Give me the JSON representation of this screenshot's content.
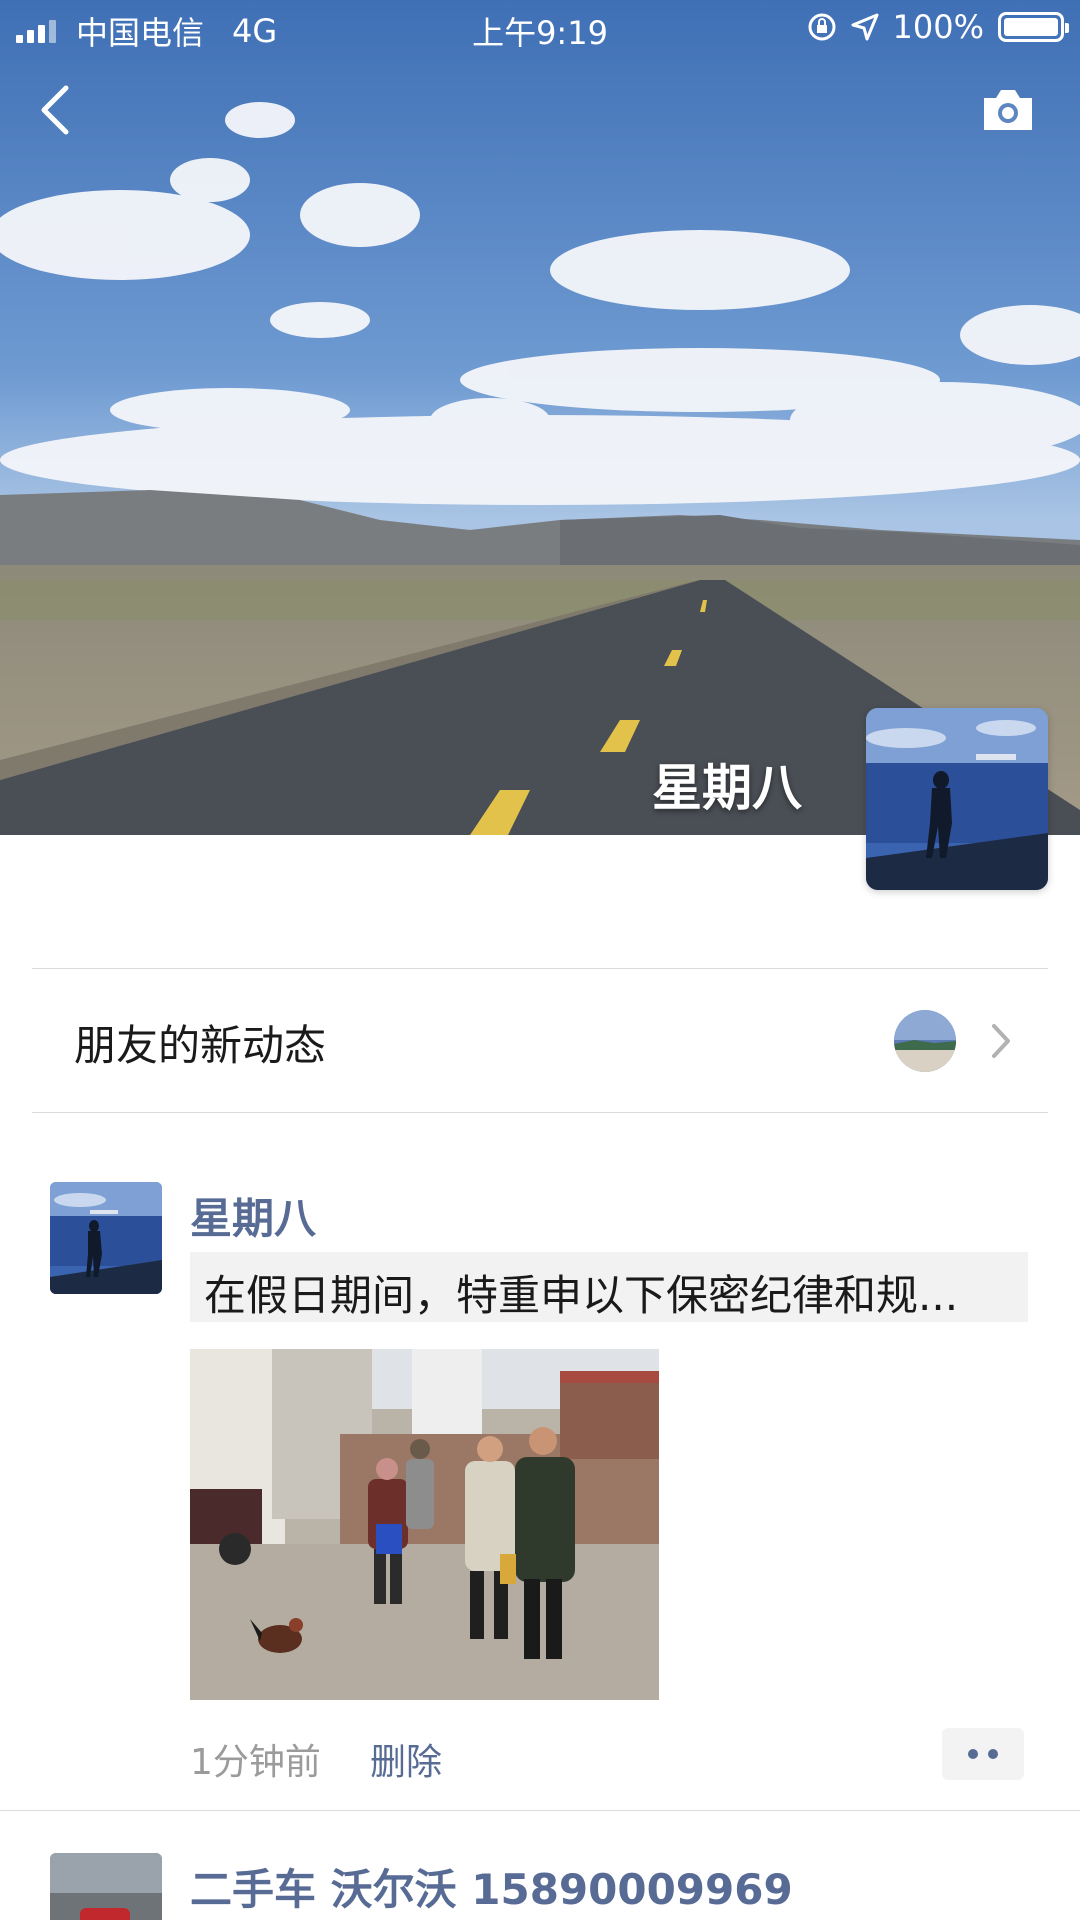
{
  "status_bar": {
    "carrier": "中国电信",
    "network": "4G",
    "time": "上午9:19",
    "battery": "100%"
  },
  "nav": {
    "back_icon": "chevron-left-icon",
    "camera_icon": "camera-icon"
  },
  "profile": {
    "name": "星期八"
  },
  "friends_updates": {
    "label": "朋友的新动态"
  },
  "post": {
    "author": "星期八",
    "text": "在假日期间，特重申以下保密纪律和规...",
    "time": "1分钟前",
    "delete_label": "删除"
  },
  "next_post": {
    "author": "二手车 沃尔沃 15890009969"
  },
  "colors": {
    "link": "#576b95",
    "meta": "#9b9b9b",
    "text_bg": "#f2f2f2"
  }
}
